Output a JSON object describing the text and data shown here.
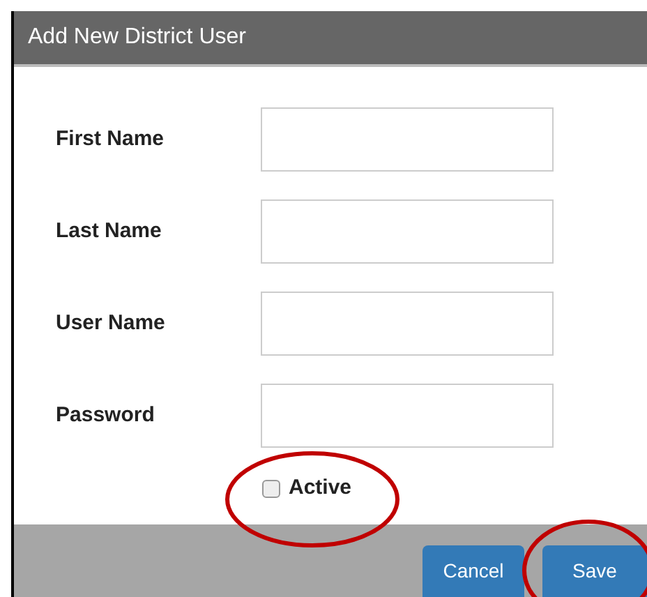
{
  "dialog": {
    "title": "Add New District User"
  },
  "fields": [
    {
      "label": "First Name"
    },
    {
      "label": "Last Name"
    },
    {
      "label": "User Name"
    },
    {
      "label": "Password"
    }
  ],
  "active": {
    "label": "Active",
    "checked": false,
    "highlighted": true
  },
  "buttons": [
    {
      "kind": "secondary",
      "label": "Cancel",
      "highlighted": false
    },
    {
      "kind": "primary",
      "label": "Save",
      "highlighted": true
    }
  ]
}
